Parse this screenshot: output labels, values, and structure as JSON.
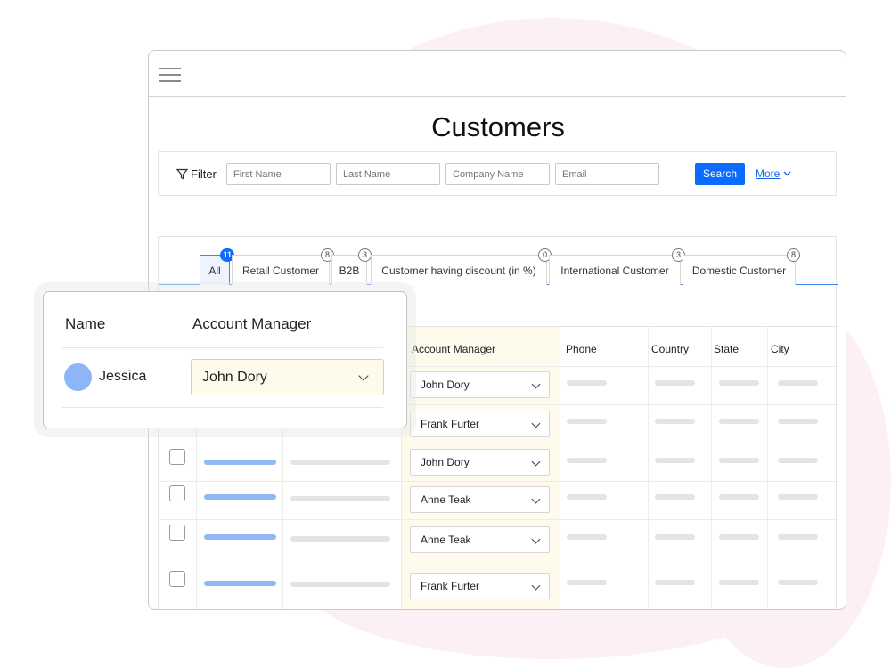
{
  "page": {
    "title": "Customers"
  },
  "filter": {
    "label": "Filter",
    "first_name_placeholder": "First Name",
    "last_name_placeholder": "Last Name",
    "company_placeholder": "Company Name",
    "email_placeholder": "Email",
    "search_label": "Search",
    "more_label": "More"
  },
  "tabs": [
    {
      "label": "All",
      "count": "11",
      "active": true
    },
    {
      "label": "Retail Customer",
      "count": "8"
    },
    {
      "label": "B2B",
      "count": "3"
    },
    {
      "label": "Customer having discount (in %)",
      "count": "0"
    },
    {
      "label": "International Customer",
      "count": "3"
    },
    {
      "label": "Domestic Customer",
      "count": "8"
    }
  ],
  "table": {
    "columns": [
      "Account Manager",
      "Phone",
      "Country",
      "State",
      "City"
    ],
    "rows": [
      {
        "account_manager": "John Dory"
      },
      {
        "account_manager": "Frank Furter"
      },
      {
        "account_manager": "John Dory"
      },
      {
        "account_manager": "Anne Teak"
      },
      {
        "account_manager": "Anne Teak"
      },
      {
        "account_manager": "Frank Furter"
      }
    ]
  },
  "popup": {
    "name_header": "Name",
    "manager_header": "Account Manager",
    "name": "Jessica",
    "manager": "John Dory"
  },
  "colors": {
    "accent": "#0b6cff",
    "highlight": "#fffbec",
    "avatar": "#8db5f8",
    "background_blob": "#fdf0f5"
  }
}
